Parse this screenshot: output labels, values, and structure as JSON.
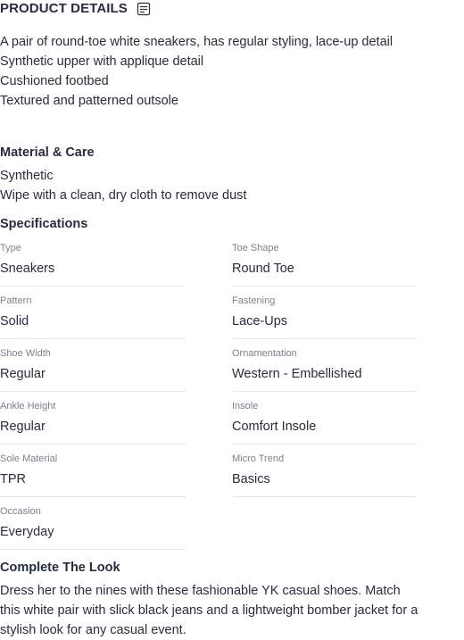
{
  "product_details": {
    "title": "PRODUCT DETAILS",
    "icon": "document-list-icon",
    "description": "A pair of round-toe white sneakers, has regular styling, lace-up detail",
    "features": [
      "Synthetic upper with applique detail",
      "Cushioned footbed",
      "Textured and patterned outsole"
    ]
  },
  "material_care": {
    "title": "Material & Care",
    "lines": [
      "Synthetic",
      "Wipe with a clean, dry cloth to remove dust"
    ]
  },
  "specifications": {
    "title": "Specifications",
    "items": [
      {
        "label": "Type",
        "value": "Sneakers"
      },
      {
        "label": "Toe Shape",
        "value": "Round Toe"
      },
      {
        "label": "Pattern",
        "value": "Solid"
      },
      {
        "label": "Fastening",
        "value": "Lace-Ups"
      },
      {
        "label": "Shoe Width",
        "value": "Regular"
      },
      {
        "label": "Ornamentation",
        "value": "Western - Embellished"
      },
      {
        "label": "Ankle Height",
        "value": "Regular"
      },
      {
        "label": "Insole",
        "value": "Comfort Insole"
      },
      {
        "label": "Sole Material",
        "value": "TPR"
      },
      {
        "label": "Micro Trend",
        "value": "Basics"
      },
      {
        "label": "Occasion",
        "value": "Everyday"
      }
    ]
  },
  "complete_the_look": {
    "title": "Complete The Look",
    "text": "Dress her to the nines with these fashionable YK casual shoes. Match this white pair with slick black jeans and a lightweight bomber jacket for a stylish look for any casual event."
  },
  "colors": {
    "text": "#282c3f",
    "label": "#7e818c",
    "divider": "#e9e9ed"
  }
}
